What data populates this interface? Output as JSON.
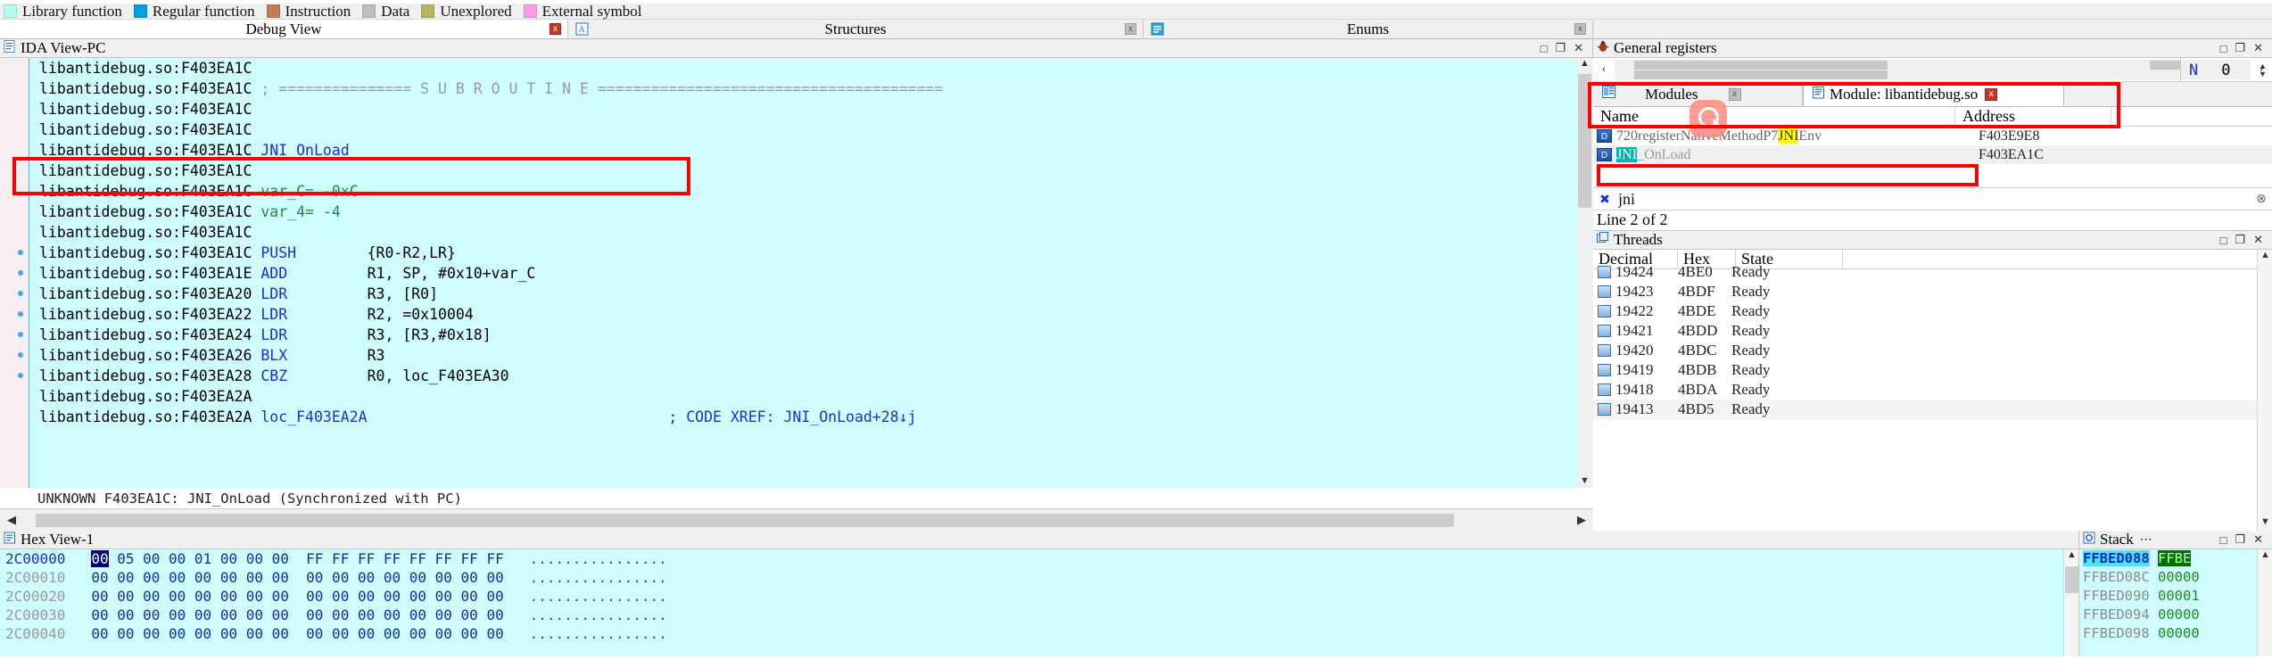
{
  "legend": {
    "items": [
      {
        "label": "Library function",
        "color": "#b3fff0"
      },
      {
        "label": "Regular function",
        "color": "#00a0e0"
      },
      {
        "label": "Instruction",
        "color": "#c07d56"
      },
      {
        "label": "Data",
        "color": "#bdbdbd"
      },
      {
        "label": "Unexplored",
        "color": "#b5b55c"
      },
      {
        "label": "External symbol",
        "color": "#ff9ae6"
      }
    ]
  },
  "tabs": [
    {
      "label": "Debug View",
      "active": true,
      "close": "x",
      "close_style": "red",
      "icon": ""
    },
    {
      "label": "Structures",
      "active": false,
      "close": "x",
      "close_style": "gray",
      "icon": "structures-icon"
    },
    {
      "label": "Enums",
      "active": false,
      "close": "x",
      "close_style": "gray",
      "icon": "enums-icon"
    }
  ],
  "ida_view": {
    "title": "IDA View-PC",
    "window_buttons": [
      "□",
      "❐",
      "✕"
    ],
    "status": "UNKNOWN F403EA1C: JNI_OnLoad (Synchronized with PC)",
    "lines": [
      {
        "seg": "libantidebug.so:F403EA1C",
        "rest": "",
        "kind": "plain",
        "dot": false
      },
      {
        "seg": "libantidebug.so:F403EA1C",
        "rest": "; =============== S U B R O U T I N E =======================================",
        "kind": "comment",
        "dot": false
      },
      {
        "seg": "libantidebug.so:F403EA1C",
        "rest": "",
        "kind": "plain",
        "dot": false
      },
      {
        "seg": "libantidebug.so:F403EA1C",
        "rest": "",
        "kind": "plain",
        "dot": false
      },
      {
        "seg": "libantidebug.so:F403EA1C",
        "rest": "JNI_OnLoad",
        "kind": "name",
        "dot": false
      },
      {
        "seg": "libantidebug.so:F403EA1C",
        "rest": "",
        "kind": "name",
        "dot": false
      },
      {
        "seg": "libantidebug.so:F403EA1C",
        "rest": "var_C= -0xC",
        "kind": "localvar",
        "dot": false
      },
      {
        "seg": "libantidebug.so:F403EA1C",
        "rest": "var_4= -4",
        "kind": "localvar",
        "dot": false
      },
      {
        "seg": "libantidebug.so:F403EA1C",
        "rest": "",
        "kind": "plain",
        "dot": false
      },
      {
        "seg": "libantidebug.so:F403EA1C",
        "mnemonic": "PUSH",
        "operand": "{R0-R2,LR}",
        "kind": "insn",
        "dot": true
      },
      {
        "seg": "libantidebug.so:F403EA1E",
        "mnemonic": "ADD",
        "operand": "R1, SP, #0x10+var_C",
        "kind": "insn",
        "dot": true
      },
      {
        "seg": "libantidebug.so:F403EA20",
        "mnemonic": "LDR",
        "operand": "R3, [R0]",
        "kind": "insn",
        "dot": true
      },
      {
        "seg": "libantidebug.so:F403EA22",
        "mnemonic": "LDR",
        "operand": "R2, =0x10004",
        "kind": "insn",
        "dot": true
      },
      {
        "seg": "libantidebug.so:F403EA24",
        "mnemonic": "LDR",
        "operand": "R3, [R3,#0x18]",
        "kind": "insn",
        "dot": true
      },
      {
        "seg": "libantidebug.so:F403EA26",
        "mnemonic": "BLX",
        "operand": "R3",
        "kind": "insn",
        "dot": true
      },
      {
        "seg": "libantidebug.so:F403EA28",
        "mnemonic": "CBZ",
        "operand": "R0, loc_F403EA30",
        "kind": "insn",
        "dot": true
      },
      {
        "seg": "libantidebug.so:F403EA2A",
        "rest": "",
        "kind": "plain",
        "dot": false
      },
      {
        "seg": "libantidebug.so:F403EA2A",
        "rest": "loc_F403EA2A",
        "xref": "; CODE XREF: JNI_OnLoad+28↓j",
        "kind": "label",
        "dot": false
      }
    ]
  },
  "registers": {
    "title": "General registers",
    "window_buttons": [
      "□",
      "❐",
      "✕"
    ],
    "flag_name": "N",
    "flag_value": "0",
    "nav_prev": "‹",
    "nav_next": "›"
  },
  "modules": {
    "tabs": [
      {
        "label": "Modules",
        "selected": false,
        "close": "x",
        "close_style": "gray",
        "icon": "modules-icon"
      },
      {
        "label": "Module: libantidebug.so",
        "selected": true,
        "close": "x",
        "close_style": "red",
        "icon": "module-icon"
      }
    ],
    "columns": [
      "Name",
      "Address"
    ],
    "rows": [
      {
        "name_plain_1": "720registerNativeMethodP7",
        "name_hl": "JNI",
        "name_plain_2": "Env",
        "address": "F403E9E8",
        "selected": false,
        "highlight": "yellow"
      },
      {
        "name_plain_1": "",
        "name_hl": "JNI",
        "name_plain_2": "_OnLoad",
        "address": "F403EA1C",
        "selected": true,
        "highlight": "teal"
      }
    ]
  },
  "find": {
    "value": "jni",
    "placeholder": "",
    "close_icon": "✖",
    "clear_icon": "⊗"
  },
  "line_info": "Line 2 of 2",
  "threads": {
    "title": "Threads",
    "window_buttons": [
      "□",
      "❐",
      "✕"
    ],
    "columns": [
      "Decimal",
      "Hex",
      "State"
    ],
    "rows": [
      {
        "decimal": "19424",
        "hex": "4BE0",
        "state": "Ready",
        "selected": false
      },
      {
        "decimal": "19423",
        "hex": "4BDF",
        "state": "Ready",
        "selected": false
      },
      {
        "decimal": "19422",
        "hex": "4BDE",
        "state": "Ready",
        "selected": false
      },
      {
        "decimal": "19421",
        "hex": "4BDD",
        "state": "Ready",
        "selected": false
      },
      {
        "decimal": "19420",
        "hex": "4BDC",
        "state": "Ready",
        "selected": false
      },
      {
        "decimal": "19419",
        "hex": "4BDB",
        "state": "Ready",
        "selected": false
      },
      {
        "decimal": "19418",
        "hex": "4BDA",
        "state": "Ready",
        "selected": false
      },
      {
        "decimal": "19413",
        "hex": "4BD5",
        "state": "Ready",
        "selected": true
      }
    ]
  },
  "hex_view": {
    "title": "Hex View-1",
    "window_buttons": [
      "□",
      "❐",
      "✕"
    ],
    "rows": [
      {
        "address": "2C00000",
        "sel_byte": "00",
        "bytes1": "05 00 00 01 00 00 00",
        "bytes2": "FF FF FF FF FF FF FF FF",
        "ascii": "................",
        "current": true
      },
      {
        "address": "2C00010",
        "sel_byte": "",
        "bytes1": "00 00 00 00 00 00 00 00",
        "bytes2": "00 00 00 00 00 00 00 00",
        "ascii": "................",
        "current": false
      },
      {
        "address": "2C00020",
        "sel_byte": "",
        "bytes1": "00 00 00 00 00 00 00 00",
        "bytes2": "00 00 00 00 00 00 00 00",
        "ascii": "................",
        "current": false
      },
      {
        "address": "2C00030",
        "sel_byte": "",
        "bytes1": "00 00 00 00 00 00 00 00",
        "bytes2": "00 00 00 00 00 00 00 00",
        "ascii": "................",
        "current": false
      },
      {
        "address": "2C00040",
        "sel_byte": "",
        "bytes1": "00 00 00 00 00 00 00 00",
        "bytes2": "00 00 00 00 00 00 00 00",
        "ascii": "................",
        "current": false
      }
    ]
  },
  "stack": {
    "title": "Stack",
    "menu_icon": "⋯",
    "window_buttons": [
      "□",
      "❐",
      "✕"
    ],
    "rows": [
      {
        "address": "FFBED088",
        "value": "FFBE",
        "selected": true
      },
      {
        "address": "FFBED08C",
        "value": "00000",
        "selected": false
      },
      {
        "address": "FFBED090",
        "value": "00001",
        "selected": false
      },
      {
        "address": "FFBED094",
        "value": "00000",
        "selected": false
      },
      {
        "address": "FFBED098",
        "value": "00000",
        "selected": false
      }
    ]
  }
}
